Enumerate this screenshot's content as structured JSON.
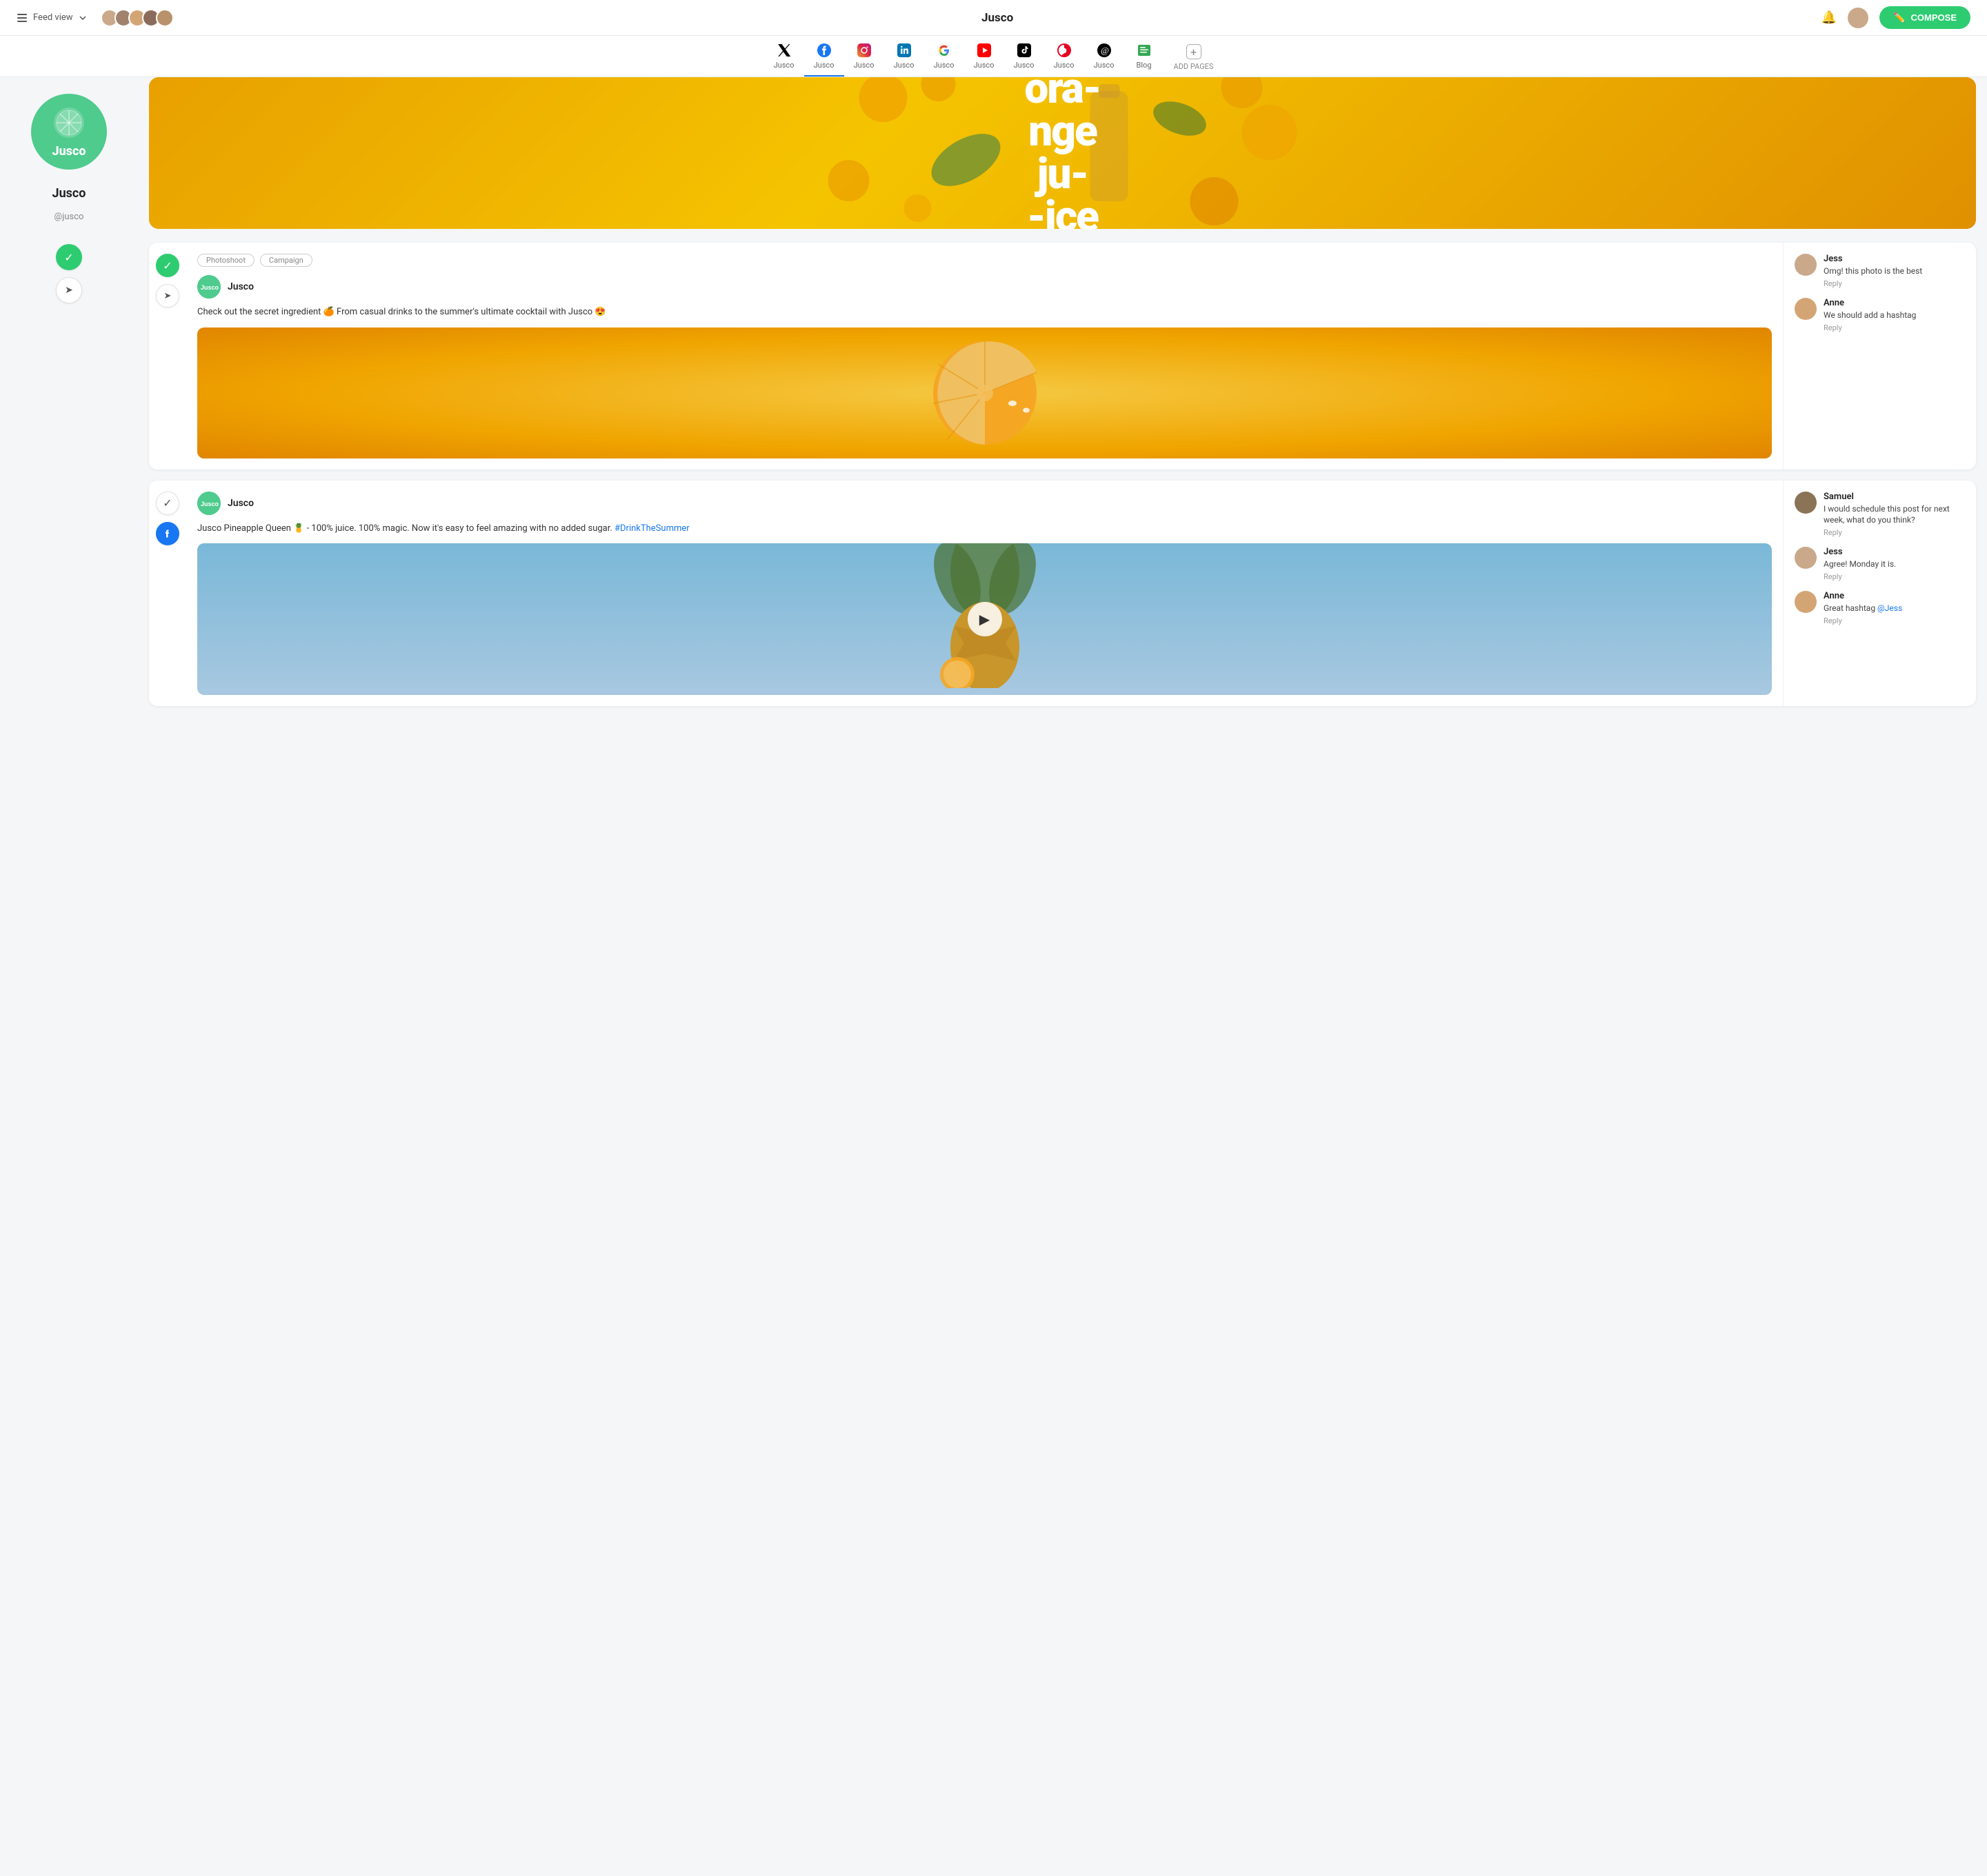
{
  "app": {
    "title": "Jusco",
    "feed_view_label": "Feed view",
    "compose_label": "COMPOSE"
  },
  "topbar": {
    "bell_label": "Notifications",
    "avatar_group": [
      "user1",
      "user2",
      "user3",
      "user4",
      "user5"
    ]
  },
  "nav": {
    "tabs": [
      {
        "id": "twitter",
        "label": "Jusco",
        "platform": "twitter",
        "active": false
      },
      {
        "id": "facebook",
        "label": "Jusco",
        "platform": "facebook",
        "active": true
      },
      {
        "id": "instagram",
        "label": "Jusco",
        "platform": "instagram",
        "active": false
      },
      {
        "id": "linkedin",
        "label": "Jusco",
        "platform": "linkedin",
        "active": false
      },
      {
        "id": "google",
        "label": "Jusco",
        "platform": "google",
        "active": false
      },
      {
        "id": "youtube",
        "label": "Jusco",
        "platform": "youtube",
        "active": false
      },
      {
        "id": "tiktok",
        "label": "Jusco",
        "platform": "tiktok",
        "active": false
      },
      {
        "id": "pinterest",
        "label": "Jusco",
        "platform": "pinterest",
        "active": false
      },
      {
        "id": "threads",
        "label": "Jusco",
        "platform": "threads",
        "active": false
      },
      {
        "id": "blog",
        "label": "Blog",
        "platform": "blog",
        "active": false
      },
      {
        "id": "add",
        "label": "ADD PAGES",
        "platform": "add",
        "active": false
      }
    ]
  },
  "sidebar": {
    "brand_name": "Jusco",
    "brand_handle": "@jusco",
    "logo_text": "Jusco",
    "actions": [
      {
        "id": "check",
        "icon": "✓",
        "active": true
      },
      {
        "id": "send",
        "icon": "➤",
        "active": false
      }
    ]
  },
  "hero": {
    "text_line1": "ora-",
    "text_line2": "nge",
    "text_line3": "ju-",
    "text_line4": "-ice"
  },
  "posts": [
    {
      "id": "post1",
      "tags": [
        "Photoshoot",
        "Campaign"
      ],
      "author": "Jusco",
      "text": "Check out the secret ingredient 🍊 From casual drinks to the summer's ultimate cocktail with Jusco 😍",
      "image_type": "orange",
      "comments": [
        {
          "author": "Jess",
          "text": "Omg! this photo is the best",
          "avatar_color": "#c9a98a"
        },
        {
          "author": "Anne",
          "text": "We should add a hashtag",
          "avatar_color": "#d4a574"
        }
      ]
    },
    {
      "id": "post2",
      "tags": [],
      "author": "Jusco",
      "text": "Jusco Pineapple Queen 🍍 - 100% juice. 100% magic. Now it's easy to feel amazing with no added sugar. #DrinkTheSummer",
      "hashtag": "#DrinkTheSummer",
      "image_type": "pineapple",
      "comments": [
        {
          "author": "Samuel",
          "text": "I would schedule this post for next week, what do you think?",
          "avatar_color": "#8b7355"
        },
        {
          "author": "Jess",
          "text": "Agree! Monday it is.",
          "avatar_color": "#c9a98a"
        },
        {
          "author": "Anne",
          "text": "Great hashtag @Jess",
          "mention": "@Jess",
          "avatar_color": "#d4a574"
        }
      ]
    }
  ],
  "sidebar2": {
    "action1_icon": "✓",
    "action2_icon": "f"
  }
}
